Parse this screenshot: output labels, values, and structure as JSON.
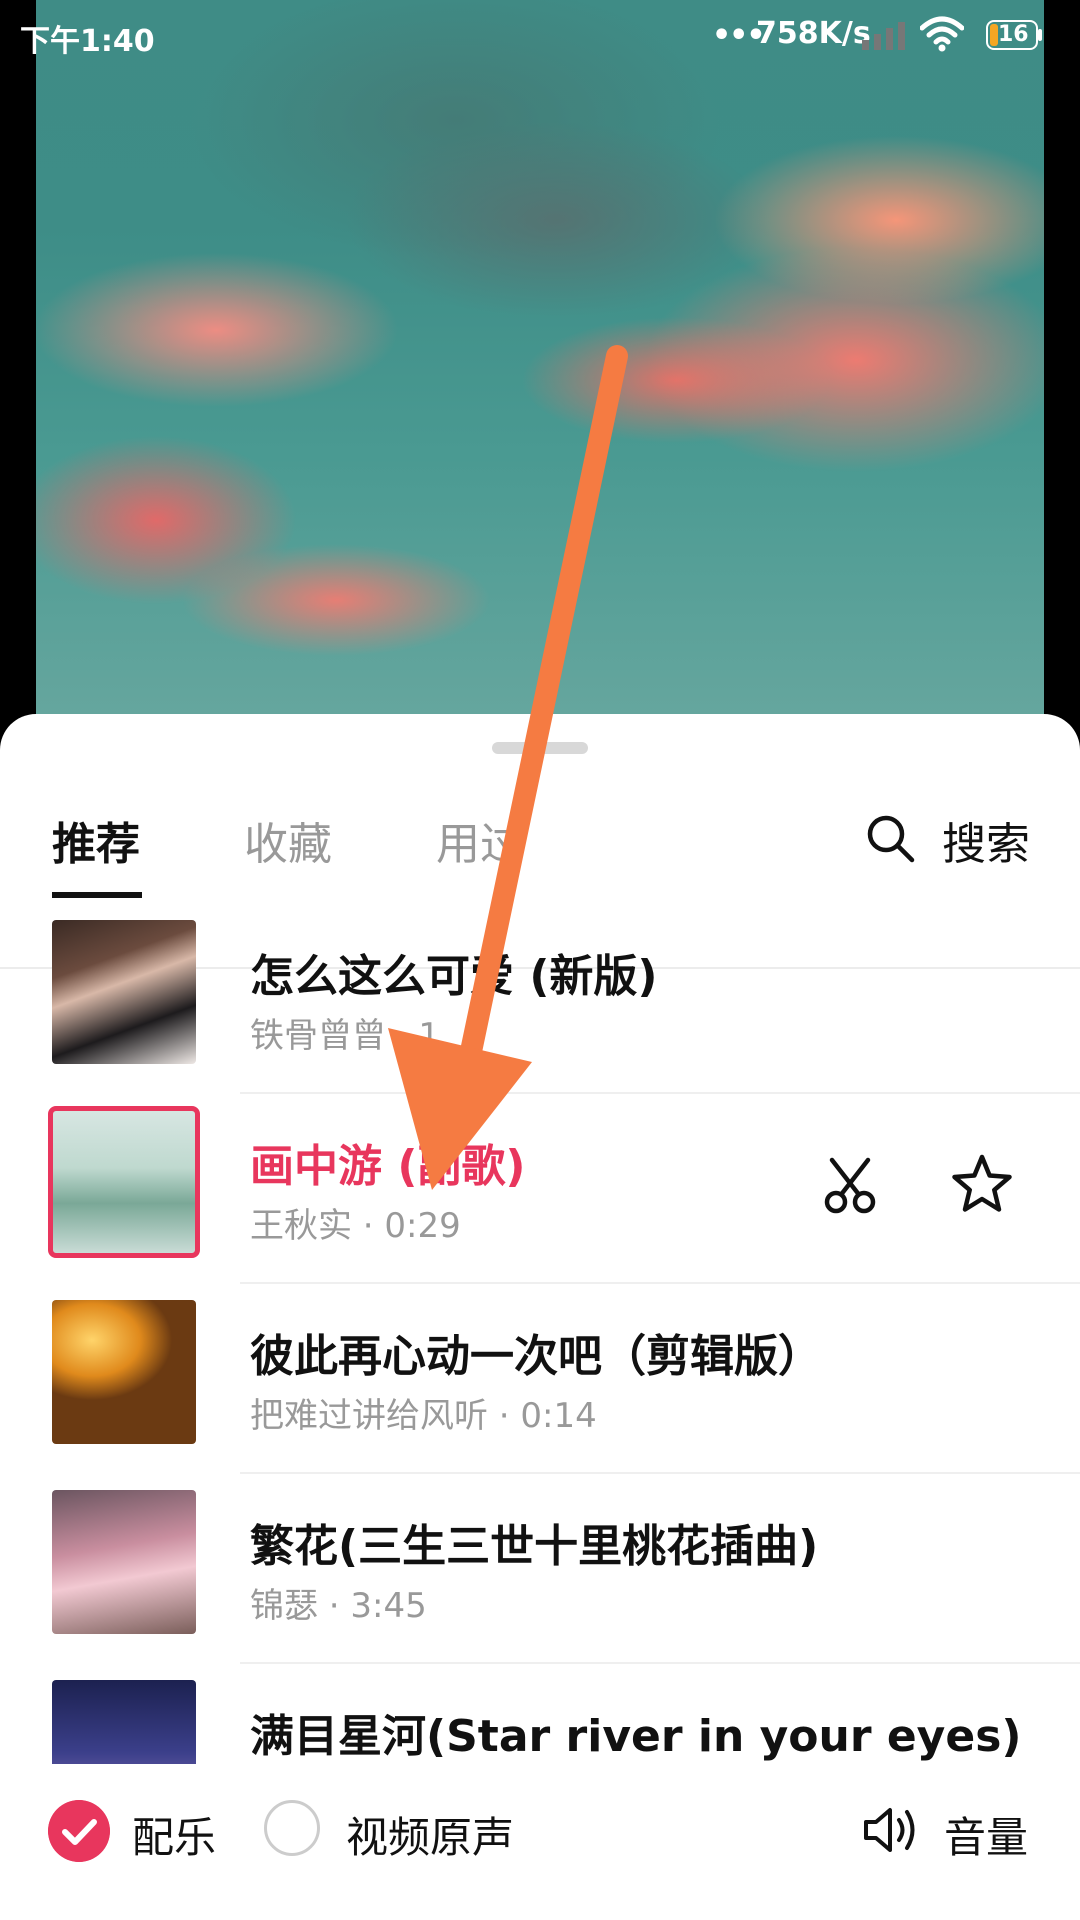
{
  "status_bar": {
    "time": "下午1:40",
    "signal_dots": "•••",
    "net_speed": "758K/s",
    "battery": "16"
  },
  "tabs": [
    {
      "label": "推荐",
      "active": true
    },
    {
      "label": "收藏",
      "active": false
    },
    {
      "label": "用过",
      "active": false
    }
  ],
  "search": {
    "label": "搜索",
    "icon": "search-icon"
  },
  "songs": [
    {
      "title": "怎么这么可爱 (新版)",
      "meta": "铁骨曾曾 · 1",
      "selected": false
    },
    {
      "title": "画中游 (副歌)",
      "meta": "王秋实 · 0:29",
      "selected": true
    },
    {
      "title": "彼此再心动一次吧（剪辑版）",
      "meta": "把难过讲给风听 · 0:14",
      "selected": false
    },
    {
      "title": "繁花(三生三世十里桃花插曲)",
      "meta": "锦瑟 · 3:45",
      "selected": false
    },
    {
      "title": "满目星河(Star river in your eyes)",
      "meta": "",
      "selected": false
    }
  ],
  "bottom": {
    "music_label": "配乐",
    "music_checked": true,
    "original_label": "视频原声",
    "original_checked": false,
    "volume_label": "音量"
  },
  "colors": {
    "accent": "#e8365d",
    "annotation_arrow": "#f57b42"
  }
}
